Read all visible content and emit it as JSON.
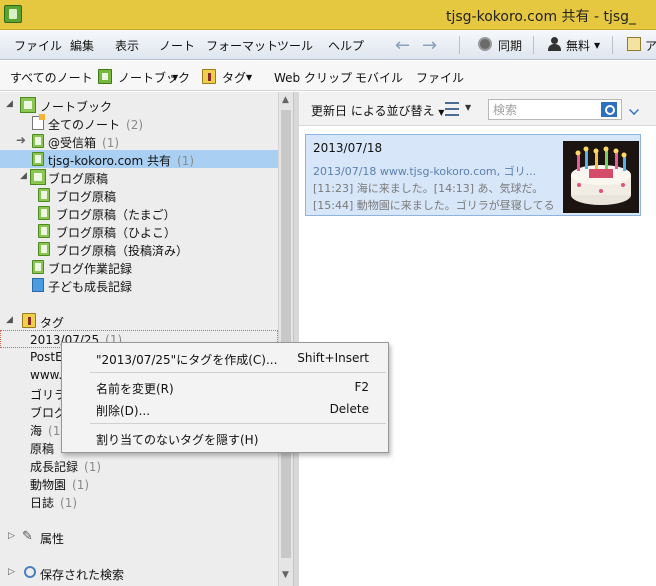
{
  "window": {
    "title": "tjsg-kokoro.com  共有 - tjsg_"
  },
  "menu": {
    "items": [
      "ファイル",
      "編集",
      "表示",
      "ノート",
      "フォーマット",
      "ツール",
      "ヘルプ"
    ],
    "sync_label": "同期",
    "account_label": "無料",
    "account_extra": "ア"
  },
  "toolbar": {
    "all_notes": "すべてのノート",
    "notebook": "ノートブック",
    "tag": "タグ",
    "web_clip": "Web クリップ",
    "mobile": "モバイル",
    "file": "ファイル"
  },
  "sidebar": {
    "notebooks_header": "ノートブック",
    "all_notes": {
      "label": "全てのノート",
      "count": "(2)"
    },
    "inbox": {
      "label": "@受信箱",
      "count": "(1)"
    },
    "shared": {
      "label": "tjsg-kokoro.com  共有",
      "count": "(1)"
    },
    "blog_stack": "ブログ原稿",
    "blog_items": [
      "ブログ原稿",
      "ブログ原稿（たまご）",
      "ブログ原稿（ひよこ）",
      "ブログ原稿（投稿済み）"
    ],
    "work_log": "ブログ作業記録",
    "kids": "子ども成長記録",
    "tags_header": "タグ",
    "tags": [
      {
        "label": "2013/07/25",
        "count": "(1)"
      },
      {
        "label": "PostE",
        "count": ""
      },
      {
        "label": "www.",
        "count": ""
      },
      {
        "label": "ゴリラ",
        "count": ""
      },
      {
        "label": "ブログ",
        "count": ""
      },
      {
        "label": "海",
        "count": "(1"
      },
      {
        "label": "原稿",
        "count": ""
      },
      {
        "label": "成長記録",
        "count": "(1)"
      },
      {
        "label": "動物園",
        "count": "(1)"
      },
      {
        "label": "日誌",
        "count": "(1)"
      }
    ],
    "attributes": "属性",
    "saved_searches": "保存された検索"
  },
  "list": {
    "sort_label": "更新日 による並び替え",
    "search_placeholder": "検索",
    "note": {
      "title": "2013/07/18",
      "line1": "2013/07/18  www.tjsg-kokoro.com, ゴリ...",
      "line2": "[11:23] 海に来ました。[14:13] あ、気球だ。",
      "line3": "[15:44] 動物園に来ました。ゴリラが昼寝してる..."
    }
  },
  "context_menu": {
    "create": {
      "label": "\"2013/07/25\"にタグを作成(C)...",
      "key": "Shift+Insert"
    },
    "rename": {
      "label": "名前を変更(R)",
      "key": "F2"
    },
    "delete": {
      "label": "削除(D)...",
      "key": "Delete"
    },
    "hide": {
      "label": "割り当てのないタグを隠す(H)",
      "key": ""
    }
  }
}
